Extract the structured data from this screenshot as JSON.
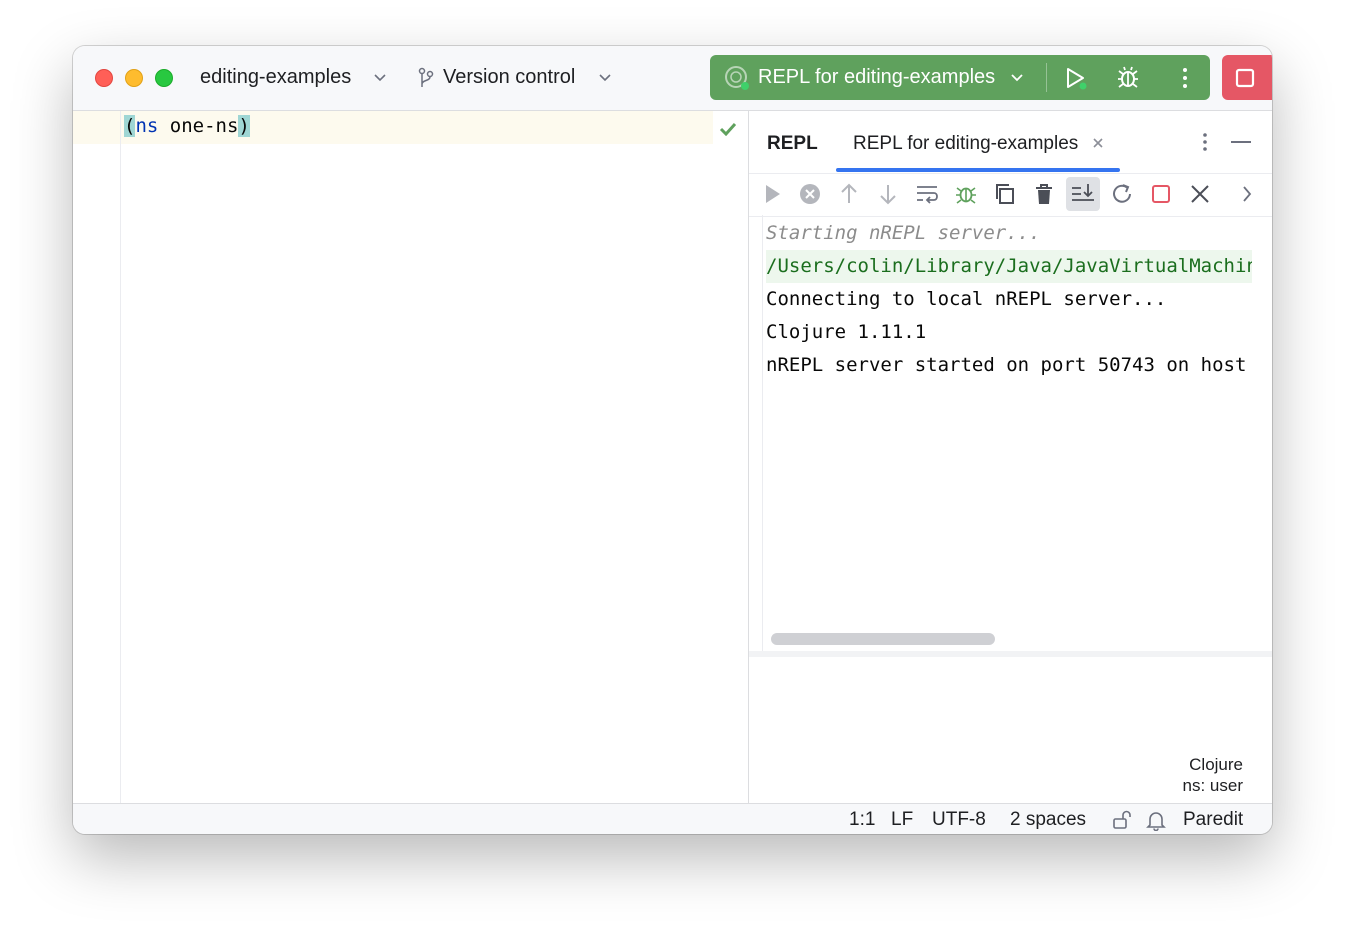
{
  "titlebar": {
    "project_name": "editing-examples",
    "vcs_label": "Version control",
    "run_config": "REPL for editing-examples",
    "icons": [
      "project-chevron-icon",
      "branch-icon",
      "repl-config-icon",
      "run-icon",
      "debug-icon",
      "more-icon",
      "stop-icon"
    ]
  },
  "editor": {
    "code_open": "(",
    "code_keyword": "ns",
    "code_rest": " one-ns",
    "code_close": ")",
    "inspection_status": "no-problems-check-icon"
  },
  "repl": {
    "tab_title": "REPL",
    "tab_active": "REPL for editing-examples",
    "toolbar_icons": [
      "execute-icon",
      "interrupt-icon",
      "history-up-icon",
      "history-down-icon",
      "soft-wrap-icon",
      "debug-icon",
      "copy-icon",
      "clear-icon",
      "scroll-to-end-icon",
      "restart-icon",
      "stop-icon",
      "close-icon",
      "expand-icon"
    ],
    "console": [
      "Starting nREPL server...",
      "/Users/colin/Library/Java/JavaVirtualMachines",
      "Connecting to local nREPL server...",
      "Clojure 1.11.1",
      "nREPL server started on port 50743 on host"
    ],
    "language": "Clojure",
    "namespace": "ns: user"
  },
  "statusbar": {
    "position": "1:1",
    "line_separator": "LF",
    "encoding": "UTF-8",
    "indent": "2 spaces",
    "mode": "Paredit"
  },
  "colors": {
    "run_green": "#5fa15d",
    "stop_red": "#e55765",
    "accent_blue": "#3574f0",
    "paren_highlight": "#9fd6d4"
  }
}
